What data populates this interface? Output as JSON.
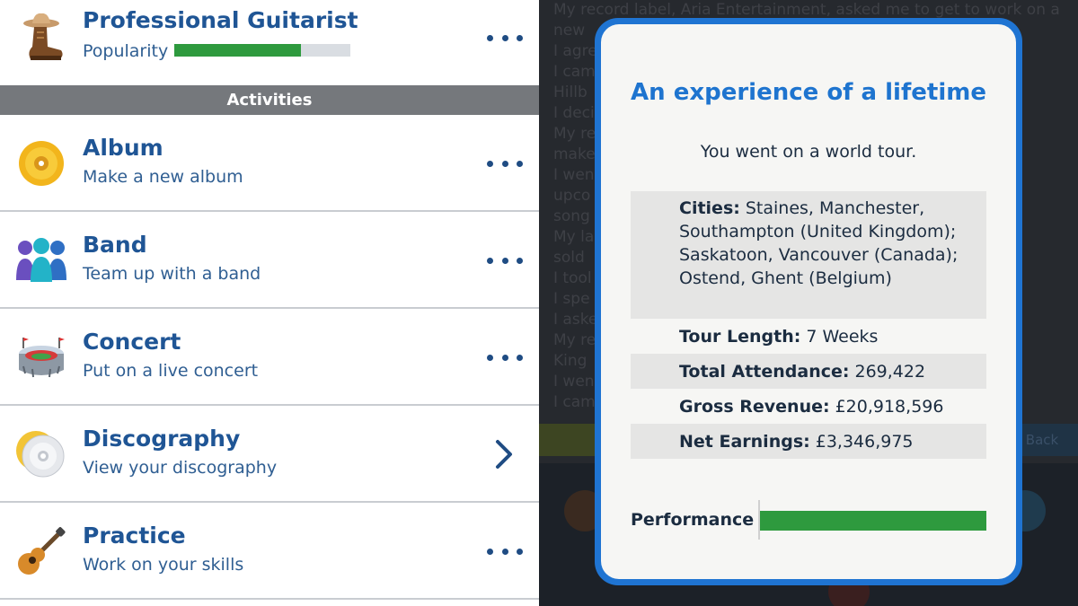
{
  "career": {
    "title": "Professional Guitarist",
    "popularity_label": "Popularity",
    "popularity": 0.72
  },
  "section_title": "Activities",
  "activities": [
    {
      "title": "Album",
      "subtitle": "Make a new album",
      "icon": "cd-icon",
      "action": "more"
    },
    {
      "title": "Band",
      "subtitle": "Team up with a band",
      "icon": "band-members-icon",
      "action": "more"
    },
    {
      "title": "Concert",
      "subtitle": "Put on a live concert",
      "icon": "stadium-icon",
      "action": "more"
    },
    {
      "title": "Discography",
      "subtitle": "View your discography",
      "icon": "cd-stack-icon",
      "action": "chevron"
    },
    {
      "title": "Practice",
      "subtitle": "Work on your skills",
      "icon": "guitar-icon",
      "action": "more"
    }
  ],
  "background": {
    "log_text": "My record label, Aria Entertainment, asked me to get to work on a\nnew\nI agre\nI cam                                                                              d\nHillb\nI deci                                                                                one'\nMy re\nmake\nI wen                                                                                 my\nupco\nsong\nMy la                                                                                 k it\nsold\nI tool\nI spe\nI aske\nMy re                                                                                 ted\nKing\nI wen\nI cam",
    "back_label": "Back"
  },
  "modal": {
    "title": "An experience of a lifetime",
    "description": "You went on a world tour.",
    "cities_label": "Cities:",
    "cities_value": "Staines, Manchester, Southampton (United Kingdom); Saskatoon, Vancouver (Canada); Ostend, Ghent (Belgium)",
    "tour_length_label": "Tour Length:",
    "tour_length_value": "7 Weeks",
    "attendance_label": "Total Attendance:",
    "attendance_value": "269,422",
    "revenue_label": "Gross Revenue:",
    "revenue_value": "£20,918,596",
    "earnings_label": "Net Earnings:",
    "earnings_value": "£3,346,975",
    "performance_label": "Performance",
    "performance": 1.0
  },
  "colors": {
    "accent_blue": "#1f74d2",
    "title_blue": "#1f5595",
    "progress_green": "#2e9a3e"
  }
}
